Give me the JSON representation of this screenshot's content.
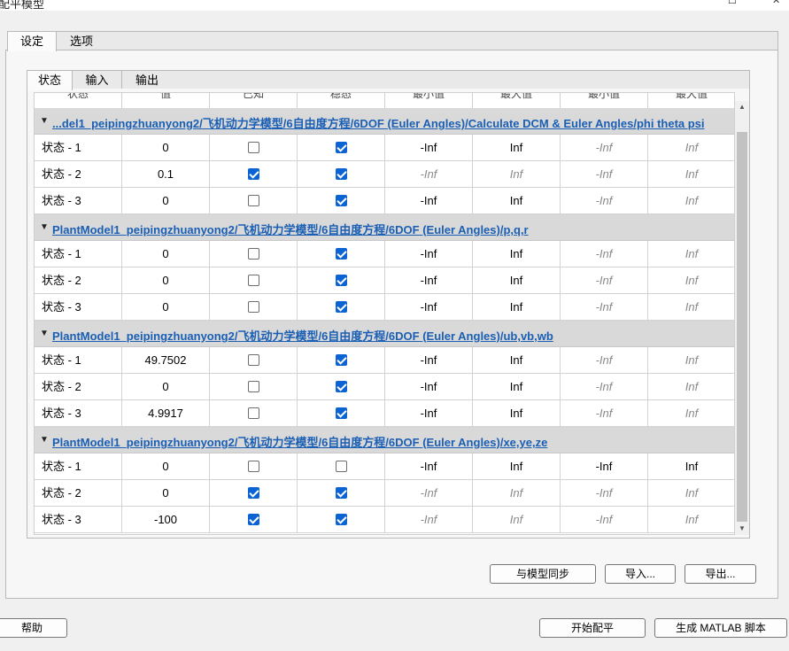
{
  "window": {
    "title": "配平模型"
  },
  "outer_tabs": [
    {
      "label": "设定"
    },
    {
      "label": "选项"
    }
  ],
  "inner_tabs": [
    {
      "label": "状态"
    },
    {
      "label": "输入"
    },
    {
      "label": "输出"
    }
  ],
  "header": {
    "columns": [
      "状态",
      "值",
      "已知",
      "稳态",
      "最小值",
      "最大值",
      "最小值",
      "最大值"
    ]
  },
  "groups": [
    {
      "path": "...del1_peipingzhuanyong2/飞机动力学模型/6自由度方程/6DOF (Euler Angles)/Calculate DCM & Euler Angles/phi theta psi",
      "rows": [
        {
          "name": "状态 - 1",
          "value": "0",
          "known": false,
          "steady": true,
          "min1": "-Inf",
          "max1": "Inf",
          "min2": "-Inf",
          "max2": "Inf"
        },
        {
          "name": "状态 - 2",
          "value": "0.1",
          "known": true,
          "steady": true,
          "min1": "-Inf",
          "max1": "Inf",
          "min2": "-Inf",
          "max2": "Inf"
        },
        {
          "name": "状态 - 3",
          "value": "0",
          "known": false,
          "steady": true,
          "min1": "-Inf",
          "max1": "Inf",
          "min2": "-Inf",
          "max2": "Inf"
        }
      ]
    },
    {
      "path": "PlantModel1_peipingzhuanyong2/飞机动力学模型/6自由度方程/6DOF (Euler Angles)/p,q,r",
      "rows": [
        {
          "name": "状态 - 1",
          "value": "0",
          "known": false,
          "steady": true,
          "min1": "-Inf",
          "max1": "Inf",
          "min2": "-Inf",
          "max2": "Inf"
        },
        {
          "name": "状态 - 2",
          "value": "0",
          "known": false,
          "steady": true,
          "min1": "-Inf",
          "max1": "Inf",
          "min2": "-Inf",
          "max2": "Inf"
        },
        {
          "name": "状态 - 3",
          "value": "0",
          "known": false,
          "steady": true,
          "min1": "-Inf",
          "max1": "Inf",
          "min2": "-Inf",
          "max2": "Inf"
        }
      ]
    },
    {
      "path": "PlantModel1_peipingzhuanyong2/飞机动力学模型/6自由度方程/6DOF (Euler Angles)/ub,vb,wb",
      "rows": [
        {
          "name": "状态 - 1",
          "value": "49.7502",
          "known": false,
          "steady": true,
          "min1": "-Inf",
          "max1": "Inf",
          "min2": "-Inf",
          "max2": "Inf"
        },
        {
          "name": "状态 - 2",
          "value": "0",
          "known": false,
          "steady": true,
          "min1": "-Inf",
          "max1": "Inf",
          "min2": "-Inf",
          "max2": "Inf"
        },
        {
          "name": "状态 - 3",
          "value": "4.9917",
          "known": false,
          "steady": true,
          "min1": "-Inf",
          "max1": "Inf",
          "min2": "-Inf",
          "max2": "Inf"
        }
      ]
    },
    {
      "path": "PlantModel1_peipingzhuanyong2/飞机动力学模型/6自由度方程/6DOF (Euler Angles)/xe,ye,ze",
      "rows": [
        {
          "name": "状态 - 1",
          "value": "0",
          "known": false,
          "steady": false,
          "min1": "-Inf",
          "max1": "Inf",
          "min2": "-Inf",
          "max2": "Inf"
        },
        {
          "name": "状态 - 2",
          "value": "0",
          "known": true,
          "steady": true,
          "min1": "-Inf",
          "max1": "Inf",
          "min2": "-Inf",
          "max2": "Inf"
        },
        {
          "name": "状态 - 3",
          "value": "-100",
          "known": true,
          "steady": true,
          "min1": "-Inf",
          "max1": "Inf",
          "min2": "-Inf",
          "max2": "Inf"
        }
      ]
    }
  ],
  "italic_rows": [
    [
      false,
      false,
      true,
      true
    ],
    [
      true,
      true,
      true,
      true
    ],
    [
      false,
      false,
      true,
      true
    ],
    [
      false,
      false,
      true,
      true
    ],
    [
      false,
      false,
      true,
      true
    ],
    [
      false,
      false,
      true,
      true
    ],
    [
      false,
      false,
      true,
      true
    ],
    [
      false,
      false,
      true,
      true
    ],
    [
      false,
      false,
      true,
      true
    ],
    [
      false,
      false,
      false,
      false
    ],
    [
      true,
      true,
      true,
      true
    ],
    [
      true,
      true,
      true,
      true
    ]
  ],
  "buttons": {
    "sync": "与模型同步",
    "import": "导入...",
    "export": "导出...",
    "help": "帮助",
    "start_trim": "开始配平",
    "gen_script": "生成 MATLAB 脚本"
  }
}
